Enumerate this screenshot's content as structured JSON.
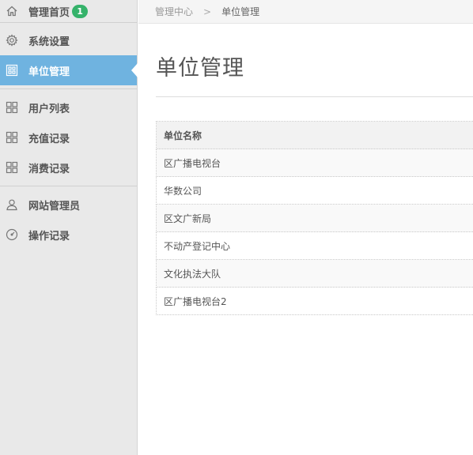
{
  "sidebar": {
    "home": {
      "label": "管理首页",
      "badge": "1"
    },
    "items": [
      {
        "label": "系统设置"
      },
      {
        "label": "单位管理"
      },
      {
        "label": "用户列表"
      },
      {
        "label": "充值记录"
      },
      {
        "label": "消费记录"
      },
      {
        "label": "网站管理员"
      },
      {
        "label": "操作记录"
      }
    ],
    "active_color": "#6fb3e0"
  },
  "breadcrumb": {
    "root": "管理中心",
    "separator": ">",
    "current": "单位管理"
  },
  "page": {
    "title": "单位管理"
  },
  "table": {
    "header": "单位名称",
    "rows": [
      "区广播电视台",
      "华数公司",
      "区文广新局",
      "不动产登记中心",
      "文化执法大队",
      "区广播电视台2"
    ]
  }
}
